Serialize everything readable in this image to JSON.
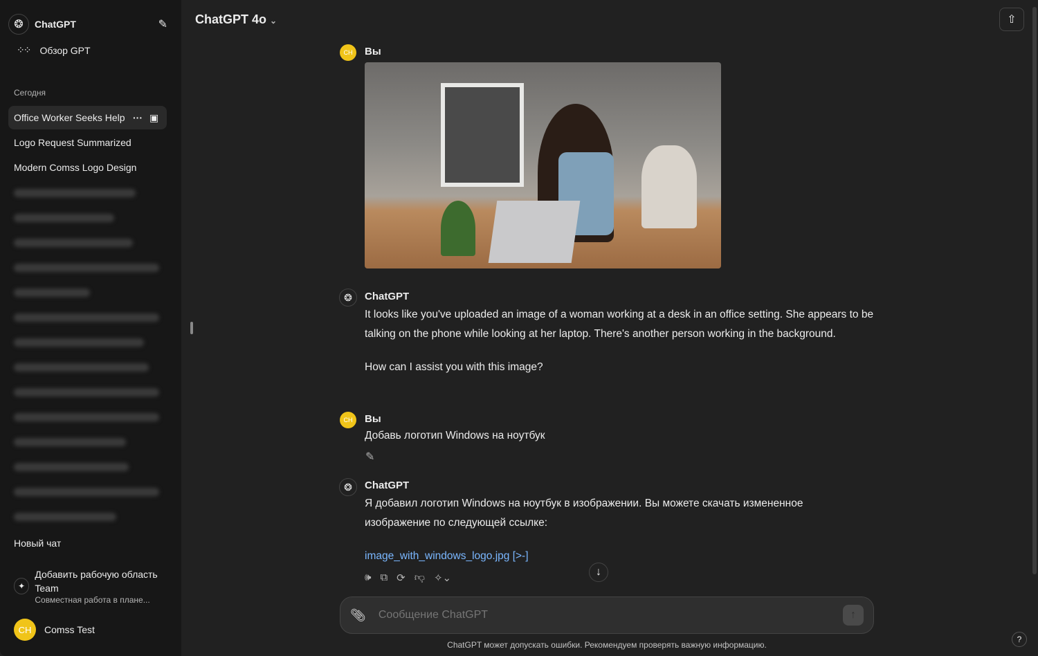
{
  "sidebar": {
    "brand": "ChatGPT",
    "explore": "Обзор GPT",
    "section_today": "Сегодня",
    "chats": [
      "Office Worker Seeks Help",
      "Logo Request Summarized",
      "Modern Comss Logo Design"
    ],
    "new_chat": "Новый чат",
    "upgrade_title": "Добавить рабочую область Team",
    "upgrade_sub": "Совместная работа в плане...",
    "user_initials": "CH",
    "user_name": "Comss Test"
  },
  "header": {
    "model": "ChatGPT 4o"
  },
  "messages": [
    {
      "author": "Вы",
      "type": "image"
    },
    {
      "author": "ChatGPT",
      "text": "It looks like you've uploaded an image of a woman working at a desk in an office setting. She appears to be talking on the phone while looking at her laptop. There's another person working in the background.",
      "text2": "How can I assist you with this image?"
    },
    {
      "author": "Вы",
      "text": "Добавь логотип Windows на ноутбук"
    },
    {
      "author": "ChatGPT",
      "text": "Я добавил логотип Windows на ноутбук в изображении. Вы можете скачать измененное изображение по следующей ссылке:",
      "link": "image_with_windows_logo.jpg",
      "link_suffix": "[>-]"
    }
  ],
  "composer": {
    "placeholder": "Сообщение ChatGPT"
  },
  "footer": {
    "disclaimer": "ChatGPT может допускать ошибки. Рекомендуем проверять важную информацию.",
    "help": "?"
  },
  "colors": {
    "accent_link": "#7ab7ff",
    "avatar": "#f0c419"
  }
}
